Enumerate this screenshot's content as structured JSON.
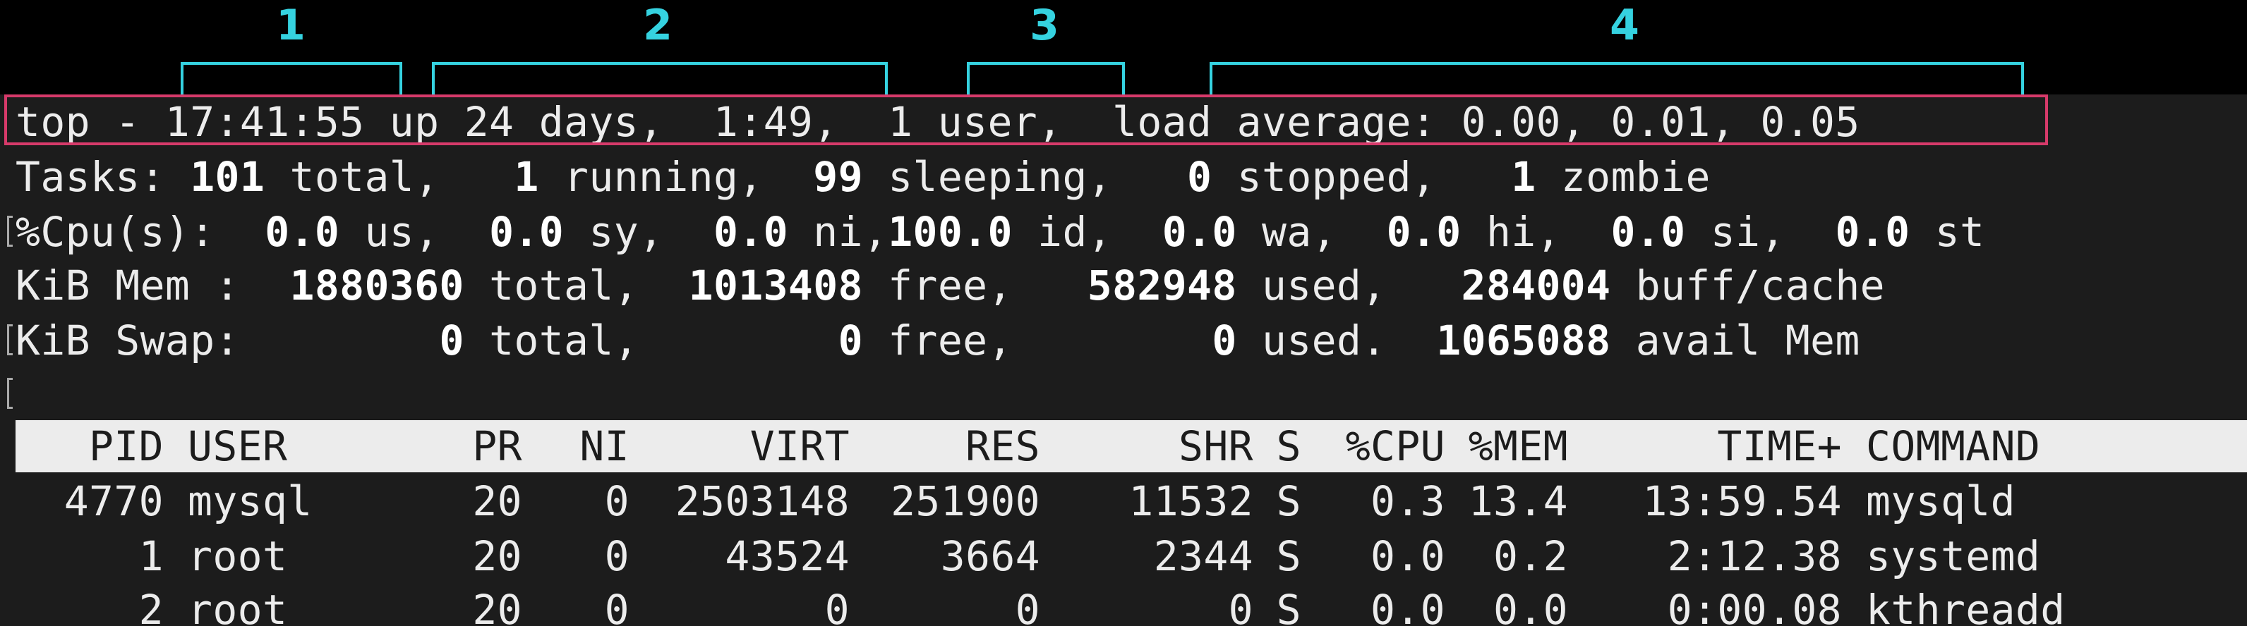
{
  "annotations": {
    "labels": [
      "1",
      "2",
      "3",
      "4"
    ]
  },
  "colors": {
    "annotation": "#35d2e0",
    "highlight_box": "#d63a6a",
    "terminal_bg": "#1c1c1c",
    "terminal_fg": "#ececec"
  },
  "summary": {
    "line1": "top - 17:41:55 up 24 days,  1:49,  1 user,  load average: 0.00, 0.01, 0.05",
    "tasks": {
      "prefix": "Tasks: ",
      "total": "101",
      "total_label": " total,   ",
      "running": "1",
      "running_label": " running,  ",
      "sleeping": "99",
      "sleeping_label": " sleeping,   ",
      "stopped": "0",
      "stopped_label": " stopped,   ",
      "zombie": "1",
      "zombie_label": " zombie"
    },
    "cpu": {
      "prefix": "%Cpu(s):  ",
      "us": "0.0",
      "us_label": " us,  ",
      "sy": "0.0",
      "sy_label": " sy,  ",
      "ni": "0.0",
      "ni_label": " ni,",
      "id": "100.0",
      "id_label": " id,  ",
      "wa": "0.0",
      "wa_label": " wa,  ",
      "hi": "0.0",
      "hi_label": " hi,  ",
      "si": "0.0",
      "si_label": " si,  ",
      "st": "0.0",
      "st_label": " st"
    },
    "mem": {
      "prefix": "KiB Mem :  ",
      "total": "1880360",
      "total_label": " total,  ",
      "free": "1013408",
      "free_label": " free,   ",
      "used": "582948",
      "used_label": " used,   ",
      "buff": "284004",
      "buff_label": " buff/cache"
    },
    "swap": {
      "prefix": "KiB Swap:        ",
      "total": "0",
      "total_label": " total,        ",
      "free": "0",
      "free_label": " free,        ",
      "used": "0",
      "used_label": " used.  ",
      "avail": "1065088",
      "avail_label": " avail Mem"
    }
  },
  "table": {
    "headers": {
      "pid": "PID",
      "user": "USER",
      "pr": "PR",
      "ni": "NI",
      "virt": "VIRT",
      "res": "RES",
      "shr": "SHR",
      "s": "S",
      "cpu": "%CPU",
      "mem": "%MEM",
      "time": "TIME+",
      "command": "COMMAND"
    },
    "rows": [
      {
        "pid": "4770",
        "user": "mysql",
        "pr": "20",
        "ni": "0",
        "virt": "2503148",
        "res": "251900",
        "shr": "11532",
        "s": "S",
        "cpu": "0.3",
        "mem": "13.4",
        "time": "13:59.54",
        "command": "mysqld"
      },
      {
        "pid": "1",
        "user": "root",
        "pr": "20",
        "ni": "0",
        "virt": "43524",
        "res": "3664",
        "shr": "2344",
        "s": "S",
        "cpu": "0.0",
        "mem": "0.2",
        "time": "2:12.38",
        "command": "systemd"
      },
      {
        "pid": "2",
        "user": "root",
        "pr": "20",
        "ni": "0",
        "virt": "0",
        "res": "0",
        "shr": "0",
        "s": "S",
        "cpu": "0.0",
        "mem": "0.0",
        "time": "0:00.08",
        "command": "kthreadd"
      }
    ]
  }
}
